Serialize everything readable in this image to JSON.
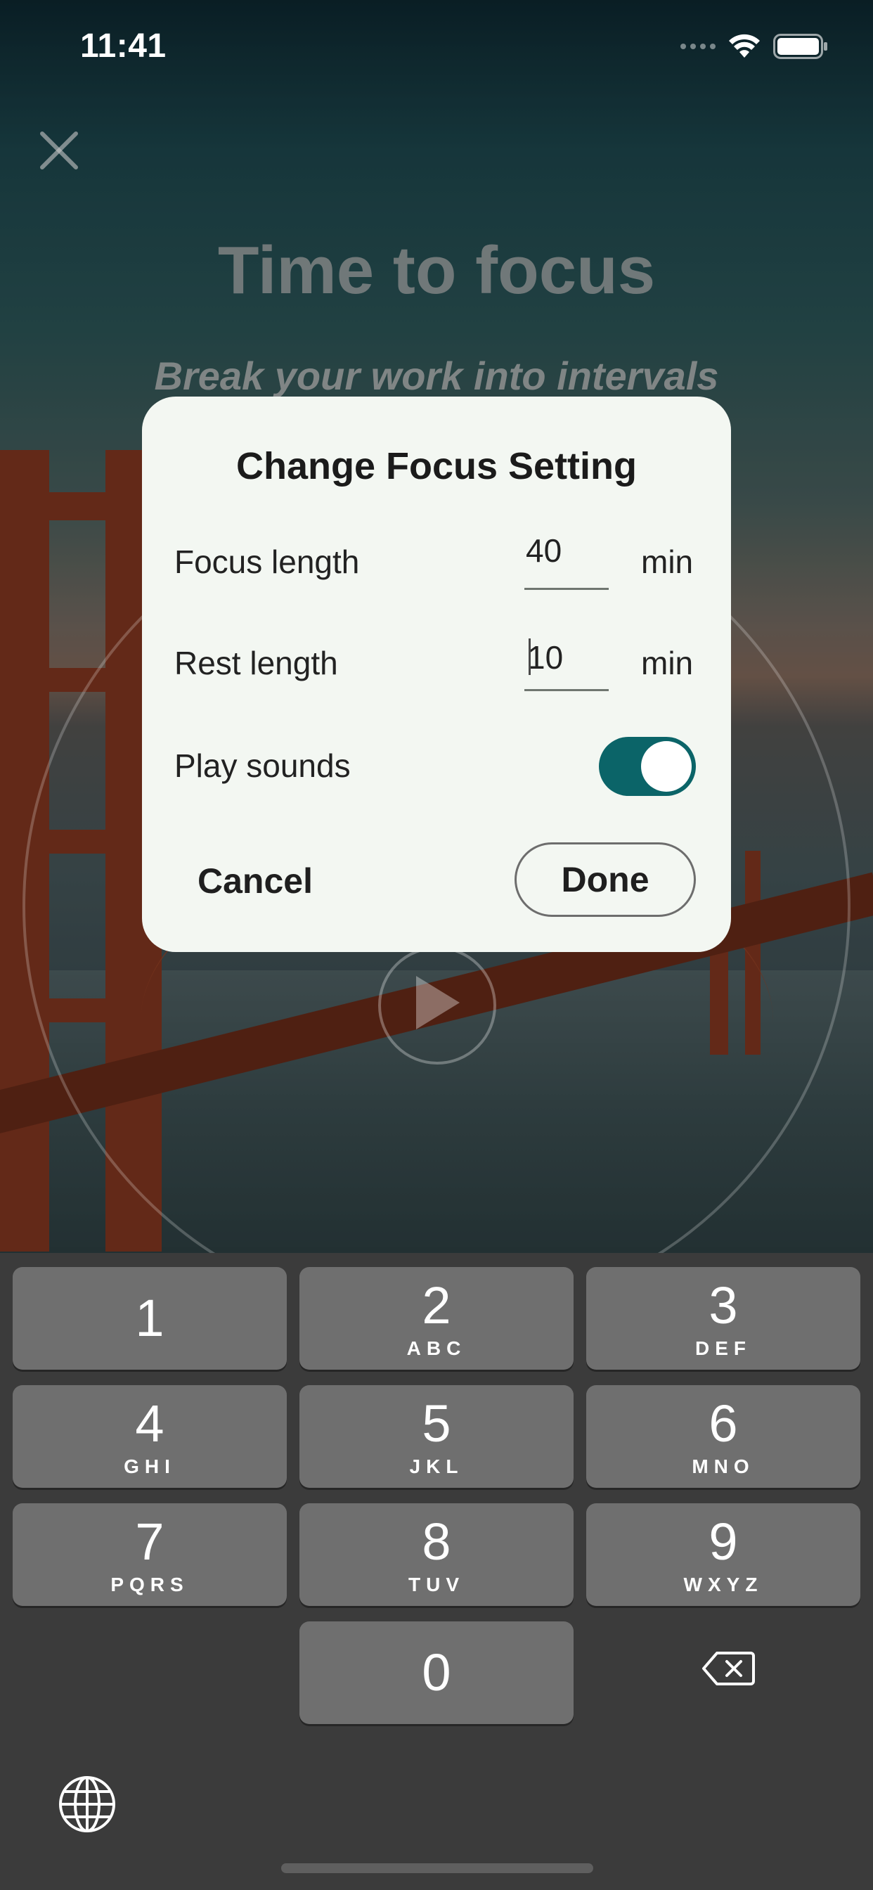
{
  "status_bar": {
    "time": "11:41"
  },
  "header": {
    "title": "Time to focus",
    "subtitle": "Break your work into intervals"
  },
  "dialog": {
    "title": "Change Focus Setting",
    "rows": [
      {
        "label": "Focus length",
        "value": "40",
        "unit": "min"
      },
      {
        "label": "Rest length",
        "value": "10",
        "unit": "min"
      }
    ],
    "play_sounds": {
      "label": "Play sounds",
      "on": true
    },
    "cancel_label": "Cancel",
    "done_label": "Done"
  },
  "keyboard": {
    "keys": [
      {
        "digit": "1",
        "letters": ""
      },
      {
        "digit": "2",
        "letters": "ABC"
      },
      {
        "digit": "3",
        "letters": "DEF"
      },
      {
        "digit": "4",
        "letters": "GHI"
      },
      {
        "digit": "5",
        "letters": "JKL"
      },
      {
        "digit": "6",
        "letters": "MNO"
      },
      {
        "digit": "7",
        "letters": "PQRS"
      },
      {
        "digit": "8",
        "letters": "TUV"
      },
      {
        "digit": "9",
        "letters": "WXYZ"
      },
      {
        "digit": "0",
        "letters": ""
      }
    ]
  },
  "colors": {
    "toggle_on": "#0b6468",
    "dialog_bg": "#f3f7f2",
    "key_bg": "#6f6f6f",
    "keyboard_bg": "#3b3b3b"
  },
  "icons": [
    "close-icon",
    "wifi-icon",
    "battery-icon",
    "play-icon",
    "backspace-icon",
    "globe-icon"
  ]
}
